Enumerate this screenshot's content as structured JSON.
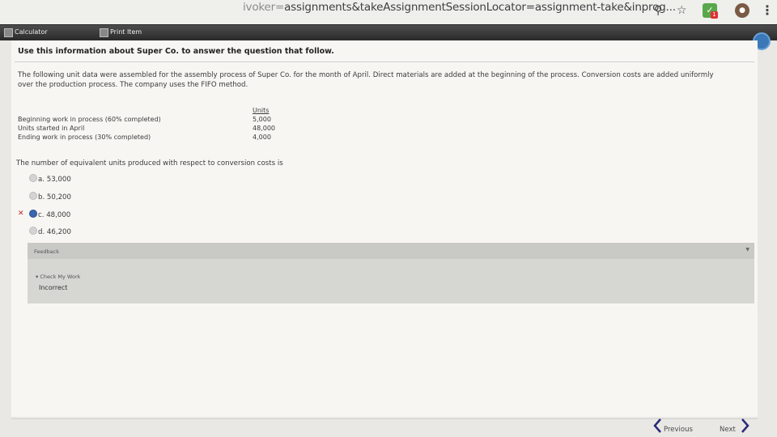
{
  "browser": {
    "url_prefix": "ivoker=",
    "url_main": "assignments&takeAssignmentSessionLocator=assignment-take&inprog...",
    "search_icon": "magnifier-icon",
    "bookmark_icon": "star-icon",
    "extension_badge": "1",
    "menu_icon": "kebab-menu-icon"
  },
  "toolbar": {
    "calculator_label": "Calculator",
    "print_label": "Print Item"
  },
  "question": {
    "heading": "Use this information about Super Co. to answer the question that follow.",
    "intro": "The following unit data were assembled for the assembly process of Super Co. for the month of April. Direct materials are added at the beginning of the process. Conversion costs are added uniformly over the production process. The company uses the FIFO method.",
    "units_header": "Units",
    "rows": [
      {
        "label": "Beginning work in process (60% completed)",
        "value": "5,000"
      },
      {
        "label": "Units started in April",
        "value": "48,000"
      },
      {
        "label": "Ending work in process (30% completed)",
        "value": "4,000"
      }
    ],
    "prompt": "The number of equivalent units produced with respect to conversion costs is",
    "options": [
      {
        "letter": "a.",
        "text": "53,000"
      },
      {
        "letter": "b.",
        "text": "50,200"
      },
      {
        "letter": "c.",
        "text": "48,000"
      },
      {
        "letter": "d.",
        "text": "46,200"
      }
    ],
    "wrong_mark": "✕"
  },
  "feedback": {
    "title": "Feedback",
    "check_label": "Check My Work",
    "result": "Incorrect"
  },
  "navigation": {
    "previous_label": "Previous",
    "next_label": "Next"
  },
  "colors": {
    "accent": "#3a66b0",
    "wrong": "#c0282a",
    "toolbar": "#333333"
  }
}
